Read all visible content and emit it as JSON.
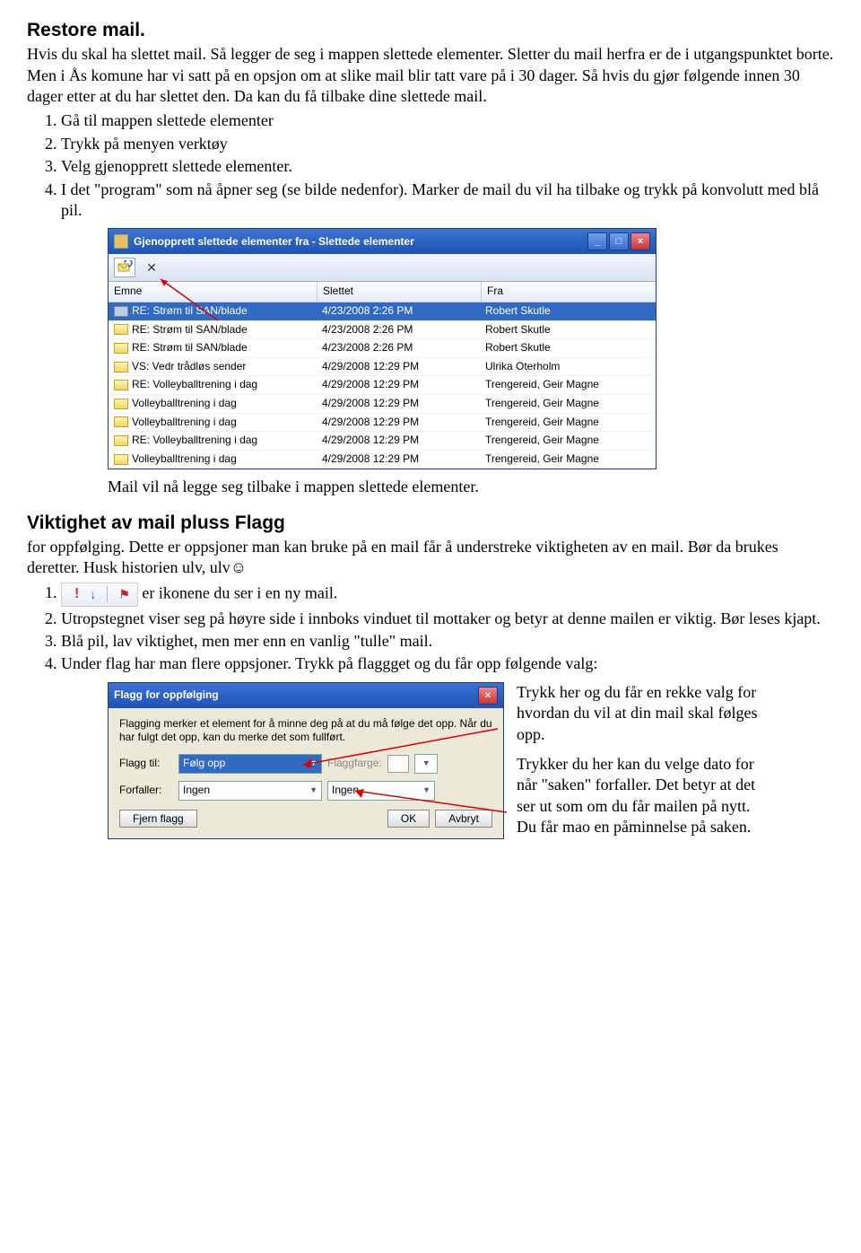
{
  "section1": {
    "title": "Restore mail.",
    "p1": "Hvis du skal ha slettet mail. Så legger de seg i mappen slettede elementer. Sletter du mail herfra er de i utgangspunktet borte. Men i Ås komune har vi satt på en opsjon om at slike mail blir tatt vare på i 30 dager. Så hvis du gjør følgende innen 30 dager etter at du har slettet den. Da kan du få tilbake dine slettede mail.",
    "steps": [
      "Gå til mappen slettede elementer",
      "Trykk på menyen verktøy",
      "Velg gjenopprett slettede elementer.",
      "I det \"program\" som nå åpner seg (se bilde nedenfor). Marker de mail du vil ha tilbake og trykk på konvolutt med blå pil."
    ],
    "after": "Mail vil nå legge seg tilbake i mappen slettede elementer."
  },
  "win": {
    "title": "Gjenopprett slettede elementer fra -  Slettede elementer",
    "cols": [
      "Emne",
      "Slettet",
      "Fra"
    ],
    "rows": [
      {
        "s": "RE: Strøm til SAN/blade",
        "d": "4/23/2008 2:26 PM",
        "f": "Robert Skutle",
        "sel": true
      },
      {
        "s": "RE: Strøm til SAN/blade",
        "d": "4/23/2008 2:26 PM",
        "f": "Robert Skutle"
      },
      {
        "s": "RE: Strøm til SAN/blade",
        "d": "4/23/2008 2:26 PM",
        "f": "Robert Skutle"
      },
      {
        "s": "VS: Vedr trådløs sender",
        "d": "4/29/2008 12:29 PM",
        "f": "Ulrika Oterholm"
      },
      {
        "s": "RE: Volleyballtrening i dag",
        "d": "4/29/2008 12:29 PM",
        "f": "Trengereid, Geir Magne"
      },
      {
        "s": "Volleyballtrening i dag",
        "d": "4/29/2008 12:29 PM",
        "f": "Trengereid, Geir Magne"
      },
      {
        "s": "Volleyballtrening i dag",
        "d": "4/29/2008 12:29 PM",
        "f": "Trengereid, Geir Magne"
      },
      {
        "s": "RE: Volleyballtrening i dag",
        "d": "4/29/2008 12:29 PM",
        "f": "Trengereid, Geir Magne"
      },
      {
        "s": "Volleyballtrening i dag",
        "d": "4/29/2008 12:29 PM",
        "f": "Trengereid, Geir Magne"
      }
    ]
  },
  "section2": {
    "title": "Viktighet av mail pluss Flagg",
    "lead": "for oppfølging. Dette er oppsjoner man kan bruke på en mail får å understreke viktigheten av en mail. Bør da brukes deretter. Husk historien ulv, ulv☺",
    "steps": [
      "er ikonene du ser i en ny mail.",
      "Utropstegnet viser seg på høyre side i innboks vinduet til mottaker og betyr at denne mailen er viktig. Bør leses kjapt.",
      "Blå pil, lav viktighet, men mer enn en vanlig \"tulle\" mail.",
      "Under flag har man flere oppsjoner. Trykk på flaggget og du får opp følgende valg:"
    ]
  },
  "dlg": {
    "title": "Flagg for oppfølging",
    "desc": "Flagging merker et element for å minne deg på at du må følge det opp. Når du har fulgt det opp, kan du merke det som fullført.",
    "flag_label": "Flagg til:",
    "flag_value": "Følg opp",
    "color_label": "Flaggfarge:",
    "due_label": "Forfaller:",
    "due_value": "Ingen",
    "due2_value": "Ingen",
    "btn_clear": "Fjern flagg",
    "btn_ok": "OK",
    "btn_cancel": "Avbryt"
  },
  "side": {
    "p1": "Trykk her og du får en rekke valg for hvordan du vil at din mail skal følges opp.",
    "p2": "Trykker du her kan du velge dato for når \"saken\" forfaller. Det betyr at det ser ut som om du får mailen på nytt. Du får mao en påminnelse på saken."
  }
}
